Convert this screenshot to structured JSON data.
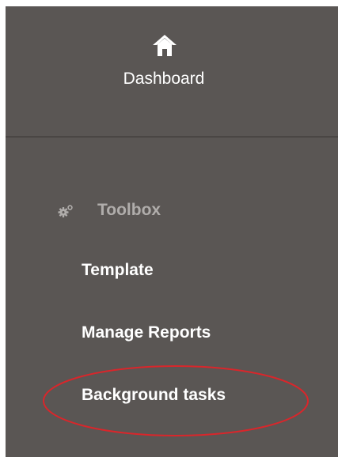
{
  "sidebar": {
    "dashboard": {
      "icon": "home-icon",
      "label": "Dashboard"
    },
    "toolbox": {
      "icon": "gears-icon",
      "label": "Toolbox",
      "items": [
        {
          "label": "Template"
        },
        {
          "label": "Manage Reports"
        },
        {
          "label": "Background tasks"
        }
      ]
    }
  },
  "annotation": {
    "shape": "ellipse",
    "target": "Background tasks",
    "color": "#d9262b"
  },
  "colors": {
    "sidebar_bg": "#5a5654",
    "text": "#ffffff",
    "section_header": "#b0adab"
  }
}
